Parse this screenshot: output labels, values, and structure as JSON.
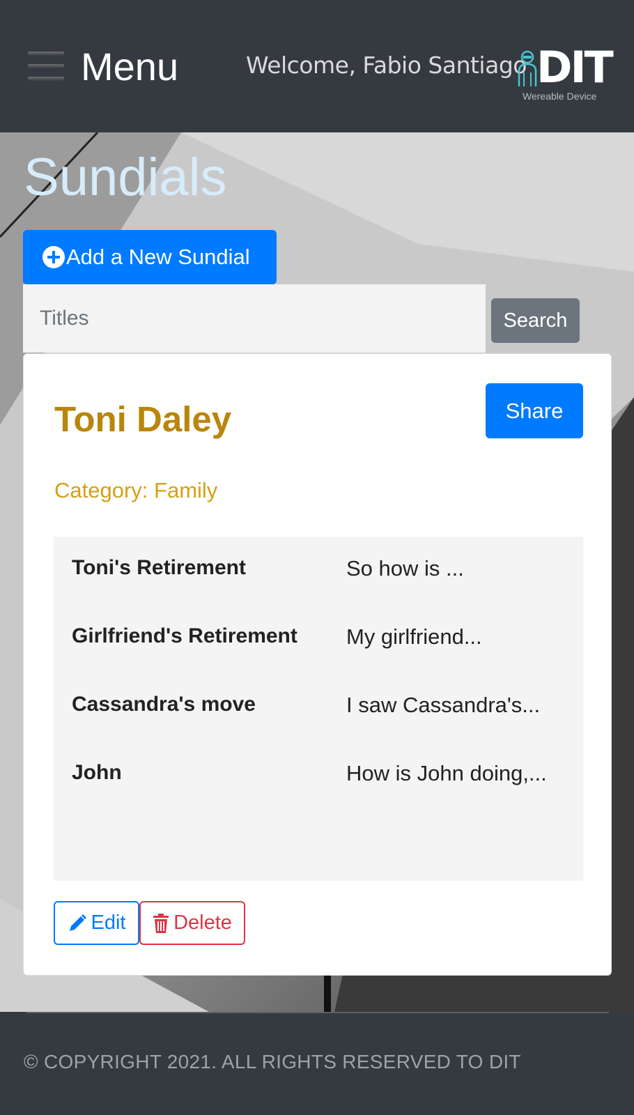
{
  "header": {
    "menu_label": "Menu",
    "welcome": "Welcome, Fabio Santiago",
    "logo_text": "DIT",
    "logo_sub": "Wereable Device"
  },
  "page": {
    "title": "Sundials",
    "add_button": "Add a New Sundial",
    "search_placeholder": "Titles",
    "search_button": "Search"
  },
  "card": {
    "title": "Toni Daley",
    "share_button": "Share",
    "category": "Category: Family",
    "entries": [
      {
        "title": "Toni's Retirement",
        "preview": "So how is ..."
      },
      {
        "title": "Girlfriend's Retirement",
        "preview": "My girlfriend..."
      },
      {
        "title": "Cassandra's move",
        "preview": "I saw Cassandra's..."
      },
      {
        "title": "John",
        "preview": "How is John doing,..."
      }
    ],
    "edit_button": "Edit",
    "delete_button": "Delete"
  },
  "footer": {
    "copyright": "© COPYRIGHT 2021. ALL RIGHTS RESERVED TO DIT"
  },
  "colors": {
    "header_bg": "#343a40",
    "primary": "#007bff",
    "secondary": "#6c757d",
    "danger": "#dc3545",
    "card_title": "#b8860b",
    "category": "#d4a017",
    "page_title": "#d7ecfb"
  },
  "icons": {
    "menu": "hamburger-icon",
    "add": "plus-circle-icon",
    "edit": "pencil-icon",
    "delete": "trash-icon",
    "logo": "person-device-icon"
  }
}
